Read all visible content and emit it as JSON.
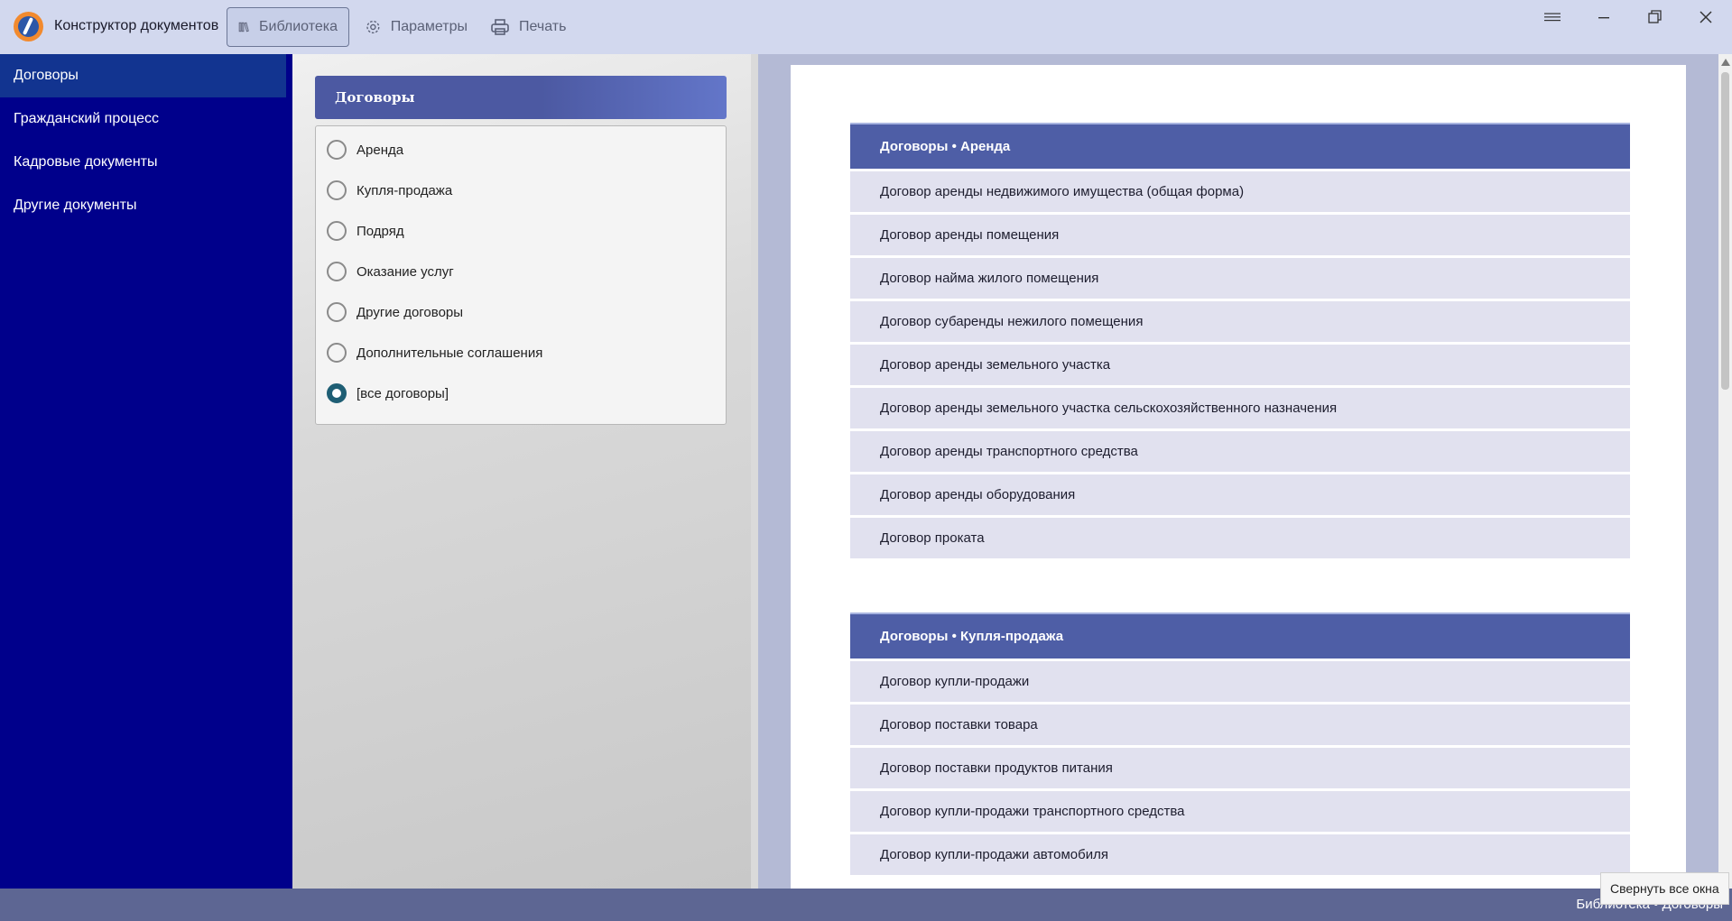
{
  "app": {
    "title": "Конструктор документов"
  },
  "toolbar": {
    "library": "Библиотека",
    "settings": "Параметры",
    "print": "Печать"
  },
  "sidebar": {
    "items": [
      {
        "label": "Договоры"
      },
      {
        "label": "Гражданский процесс"
      },
      {
        "label": "Кадровые документы"
      },
      {
        "label": "Другие документы"
      }
    ]
  },
  "category": {
    "title": "Договоры",
    "options": [
      {
        "label": "Аренда",
        "checked": false
      },
      {
        "label": "Купля-продажа",
        "checked": false
      },
      {
        "label": "Подряд",
        "checked": false
      },
      {
        "label": "Оказание услуг",
        "checked": false
      },
      {
        "label": "Другие договоры",
        "checked": false
      },
      {
        "label": "Дополнительные соглашения",
        "checked": false
      },
      {
        "label": "[все договоры]",
        "checked": true
      }
    ]
  },
  "documents": {
    "sections": [
      {
        "title": "Договоры • Аренда",
        "items": [
          "Договор аренды недвижимого имущества (общая форма)",
          "Договор аренды помещения",
          "Договор найма жилого помещения",
          "Договор субаренды нежилого помещения",
          "Договор аренды земельного участка",
          "Договор аренды земельного участка сельскохозяйственного назначения",
          "Договор аренды транспортного средства",
          "Договор аренды оборудования",
          "Договор проката"
        ]
      },
      {
        "title": "Договоры • Купля-продажа",
        "items": [
          "Договор купли-продажи",
          "Договор поставки товара",
          "Договор поставки продуктов питания",
          "Договор купли-продажи транспортного средства",
          "Договор купли-продажи автомобиля"
        ]
      }
    ]
  },
  "statusbar": {
    "path": "Библиотека • Договоры"
  },
  "tooltip": {
    "text": "Свернуть все окна"
  },
  "colors": {
    "sidebar": "#00008b",
    "section_header": "#4e5ea6",
    "row": "#e1e1ef",
    "statusbar": "#5d6693"
  }
}
